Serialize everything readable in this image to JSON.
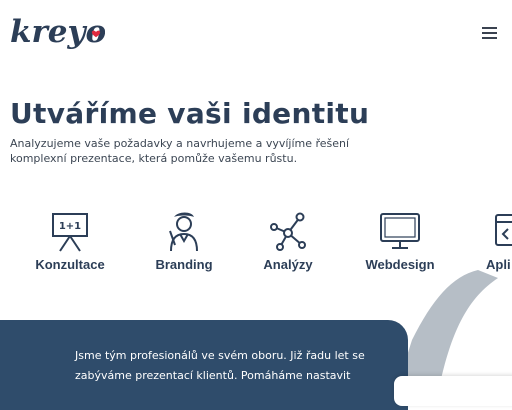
{
  "header": {
    "logo_text": "kreyo",
    "menu_icon": "hamburger-icon"
  },
  "hero": {
    "title": "Utváříme vaši identitu",
    "subtitle": "Analyzujeme vaše požadavky a navrhujeme a vyvíjíme řešení komplexní prezentace, která pomůže vašemu růstu."
  },
  "services": [
    {
      "label": "Konzultace",
      "icon": "whiteboard-icon",
      "icon_text": "1+1"
    },
    {
      "label": "Branding",
      "icon": "artist-icon"
    },
    {
      "label": "Analýzy",
      "icon": "network-icon"
    },
    {
      "label": "Webdesign",
      "icon": "monitor-icon"
    },
    {
      "label": "Apli",
      "icon": "app-window-icon"
    }
  ],
  "about": {
    "text": "Jsme tým profesionálů ve svém oboru. Již řadu let se zabýváme prezentací klientů. Pomáháme nastavit"
  },
  "colors": {
    "brand_navy": "#2c3e57",
    "panel_blue": "#2f4c6b",
    "heart_red": "#e0293f",
    "swoosh_gray": "#b6bec6"
  }
}
